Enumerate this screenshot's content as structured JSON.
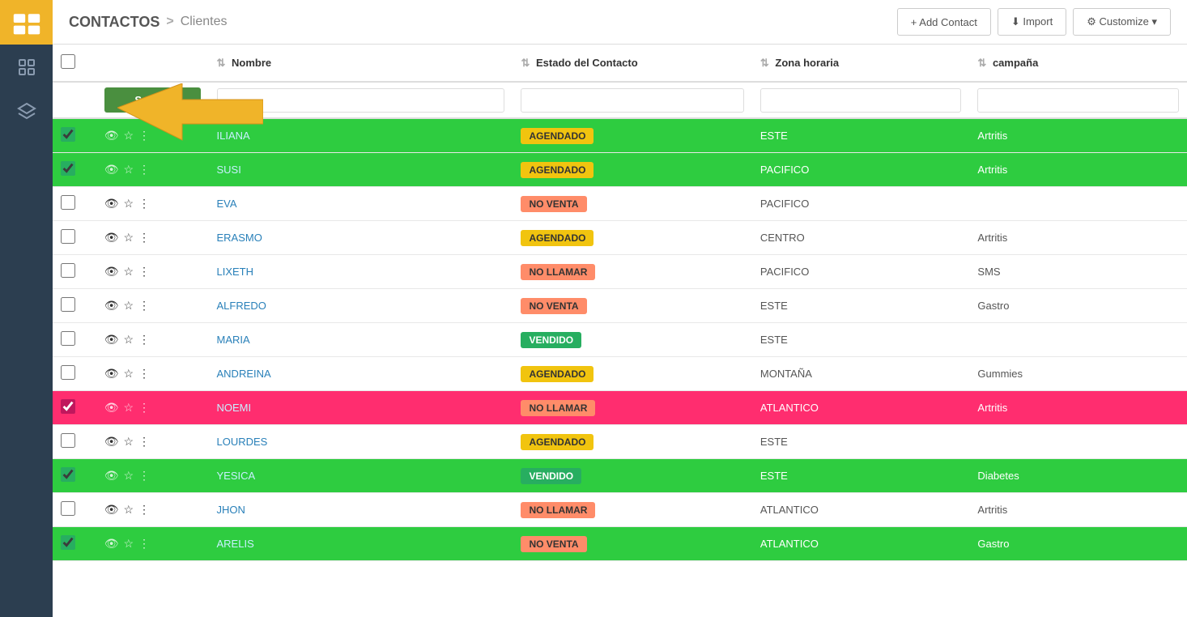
{
  "sidebar": {
    "logo_label": "CRM Logo",
    "icons": [
      {
        "name": "contacts-icon",
        "symbol": "👤"
      },
      {
        "name": "layers-icon",
        "symbol": "⧉"
      }
    ]
  },
  "header": {
    "title": "CONTACTOS",
    "breadcrumb_sep": ">",
    "breadcrumb_sub": "Clientes",
    "buttons": [
      {
        "name": "add-contact-button",
        "label": "+ Add Contact"
      },
      {
        "name": "import-button",
        "label": "⬇ Import"
      },
      {
        "name": "customize-button",
        "label": "⚙ Customize ▾"
      }
    ]
  },
  "table": {
    "columns": [
      {
        "key": "check",
        "label": ""
      },
      {
        "key": "actions",
        "label": ""
      },
      {
        "key": "nombre",
        "label": "Nombre"
      },
      {
        "key": "estado",
        "label": "Estado del Contacto"
      },
      {
        "key": "zona",
        "label": "Zona horaria"
      },
      {
        "key": "campana",
        "label": "campaña"
      }
    ],
    "search_button_label": "Search",
    "rows": [
      {
        "id": 1,
        "name": "ILIANA",
        "estado": "AGENDADO",
        "estado_type": "agendado",
        "zona": "ESTE",
        "campana": "Artritis",
        "row_style": "green",
        "checked": true
      },
      {
        "id": 2,
        "name": "SUSI",
        "estado": "AGENDADO",
        "estado_type": "agendado",
        "zona": "PACIFICO",
        "campana": "Artritis",
        "row_style": "green",
        "checked": true
      },
      {
        "id": 3,
        "name": "EVA",
        "estado": "NO VENTA",
        "estado_type": "no-venta",
        "zona": "PACIFICO",
        "campana": "",
        "row_style": "white",
        "checked": false
      },
      {
        "id": 4,
        "name": "ERASMO",
        "estado": "AGENDADO",
        "estado_type": "agendado",
        "zona": "CENTRO",
        "campana": "Artritis",
        "row_style": "white",
        "checked": false
      },
      {
        "id": 5,
        "name": "LIXETH",
        "estado": "NO LLAMAR",
        "estado_type": "no-llamar",
        "zona": "PACIFICO",
        "campana": "SMS",
        "row_style": "white",
        "checked": false
      },
      {
        "id": 6,
        "name": "ALFREDO",
        "estado": "NO VENTA",
        "estado_type": "no-venta",
        "zona": "ESTE",
        "campana": "Gastro",
        "row_style": "white",
        "checked": false
      },
      {
        "id": 7,
        "name": "MARIA",
        "estado": "VENDIDO",
        "estado_type": "vendido",
        "zona": "ESTE",
        "campana": "",
        "row_style": "white",
        "checked": false
      },
      {
        "id": 8,
        "name": "ANDREINA",
        "estado": "AGENDADO",
        "estado_type": "agendado",
        "zona": "MONTAÑA",
        "campana": "Gummies",
        "row_style": "white",
        "checked": false
      },
      {
        "id": 9,
        "name": "NOEMI",
        "estado": "NO LLAMAR",
        "estado_type": "no-llamar",
        "zona": "ATLANTICO",
        "campana": "Artritis",
        "row_style": "pink",
        "checked": true
      },
      {
        "id": 10,
        "name": "LOURDES",
        "estado": "AGENDADO",
        "estado_type": "agendado",
        "zona": "ESTE",
        "campana": "",
        "row_style": "white",
        "checked": false
      },
      {
        "id": 11,
        "name": "YESICA",
        "estado": "VENDIDO",
        "estado_type": "vendido",
        "zona": "ESTE",
        "campana": "Diabetes",
        "row_style": "green",
        "checked": true
      },
      {
        "id": 12,
        "name": "JHON",
        "estado": "NO LLAMAR",
        "estado_type": "no-llamar",
        "zona": "ATLANTICO",
        "campana": "Artritis",
        "row_style": "white",
        "checked": false
      },
      {
        "id": 13,
        "name": "ARELIS",
        "estado": "NO VENTA",
        "estado_type": "no-venta",
        "zona": "ATLANTICO",
        "campana": "Gastro",
        "row_style": "green",
        "checked": true
      }
    ]
  }
}
